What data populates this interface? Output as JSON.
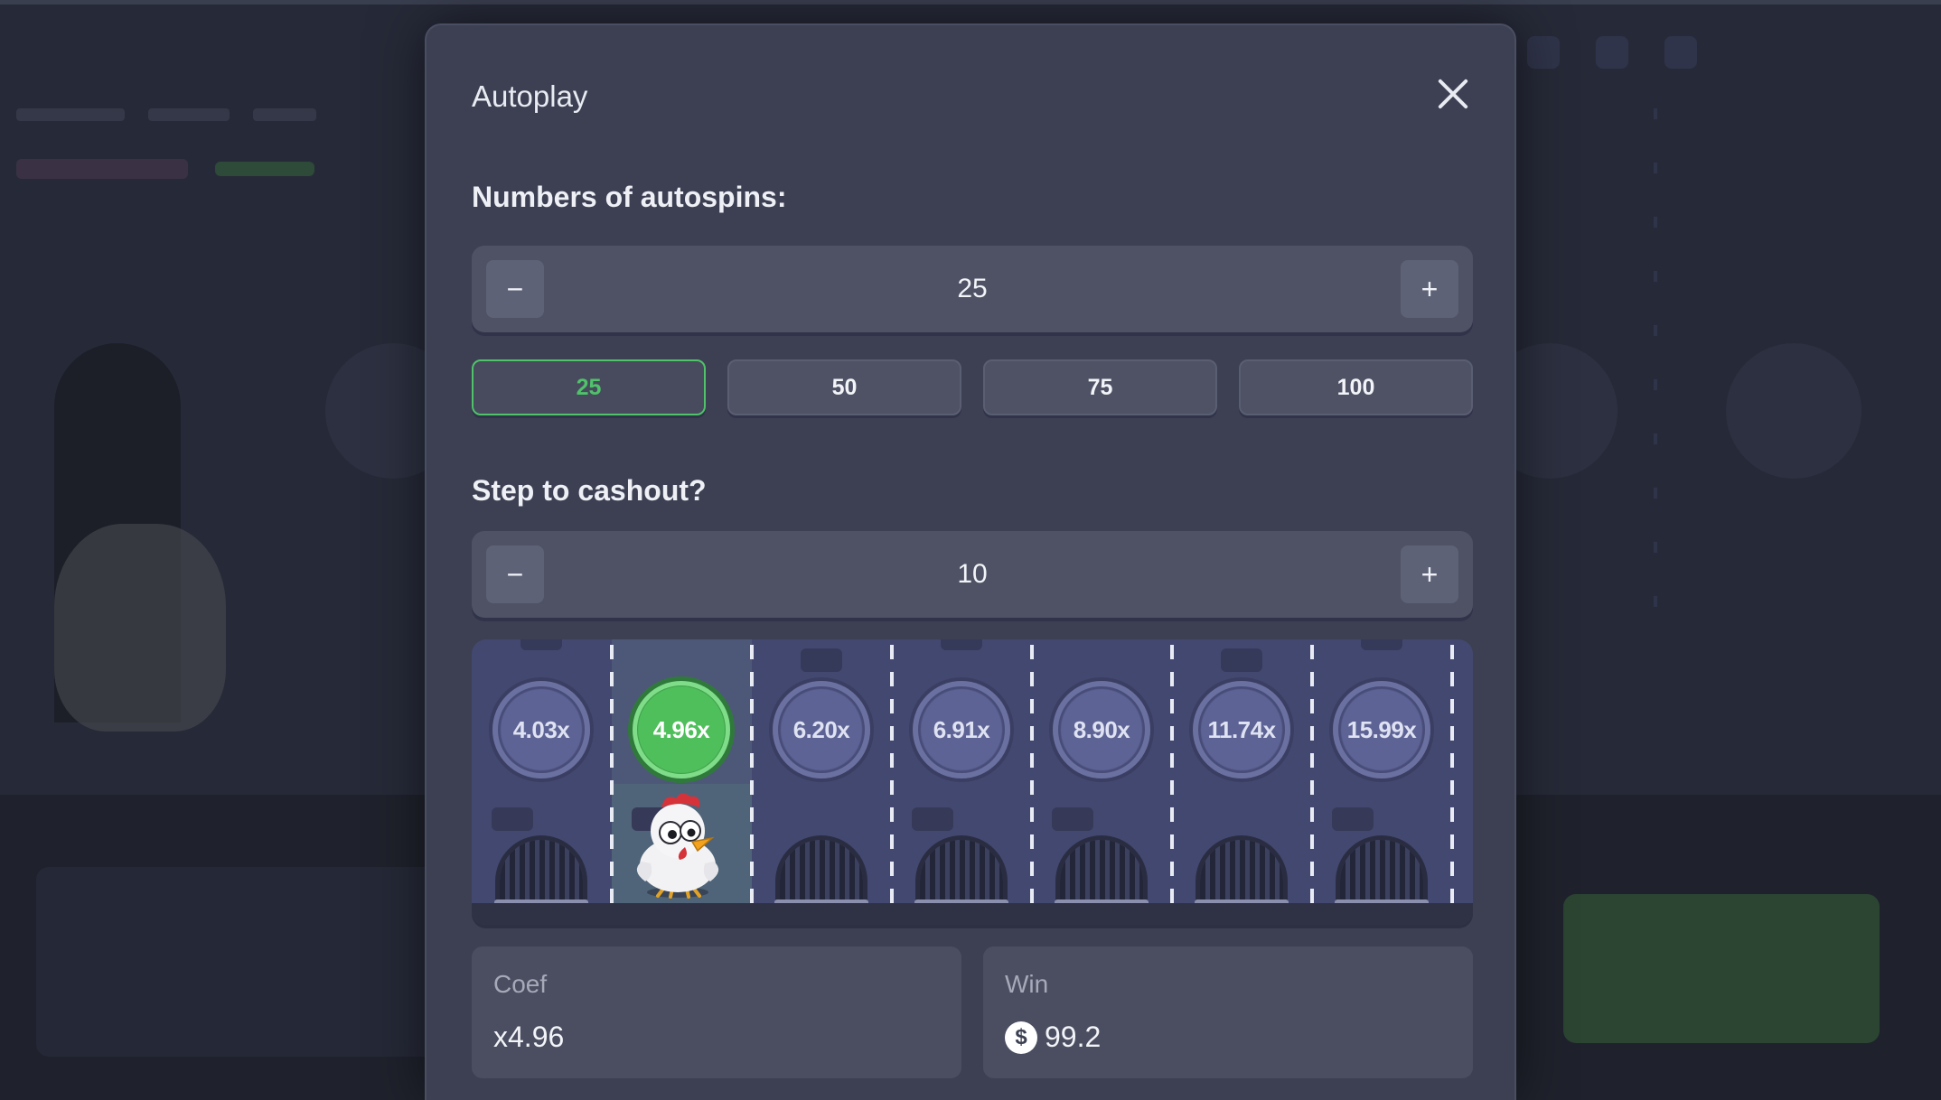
{
  "modal": {
    "title": "Autoplay",
    "close_icon": "close-icon"
  },
  "autospins": {
    "label": "Numbers of autospins:",
    "value": "25",
    "minus_label": "−",
    "plus_label": "+",
    "presets": [
      {
        "label": "25",
        "selected": true
      },
      {
        "label": "50",
        "selected": false
      },
      {
        "label": "75",
        "selected": false
      },
      {
        "label": "100",
        "selected": false
      }
    ]
  },
  "cashout": {
    "label": "Step to cashout?",
    "value": "10",
    "minus_label": "−",
    "plus_label": "+"
  },
  "road": {
    "multipliers": [
      "4.03x",
      "4.96x",
      "6.20x",
      "6.91x",
      "8.90x",
      "11.74x",
      "15.99x"
    ],
    "current_index": 1
  },
  "coef": {
    "label": "Coef",
    "value": "x4.96"
  },
  "win": {
    "label": "Win",
    "currency_symbol": "$",
    "value": "99.2"
  },
  "colors": {
    "accent_green": "#4fc26a",
    "modal_bg": "#3c4052",
    "road_bg": "#434870"
  }
}
